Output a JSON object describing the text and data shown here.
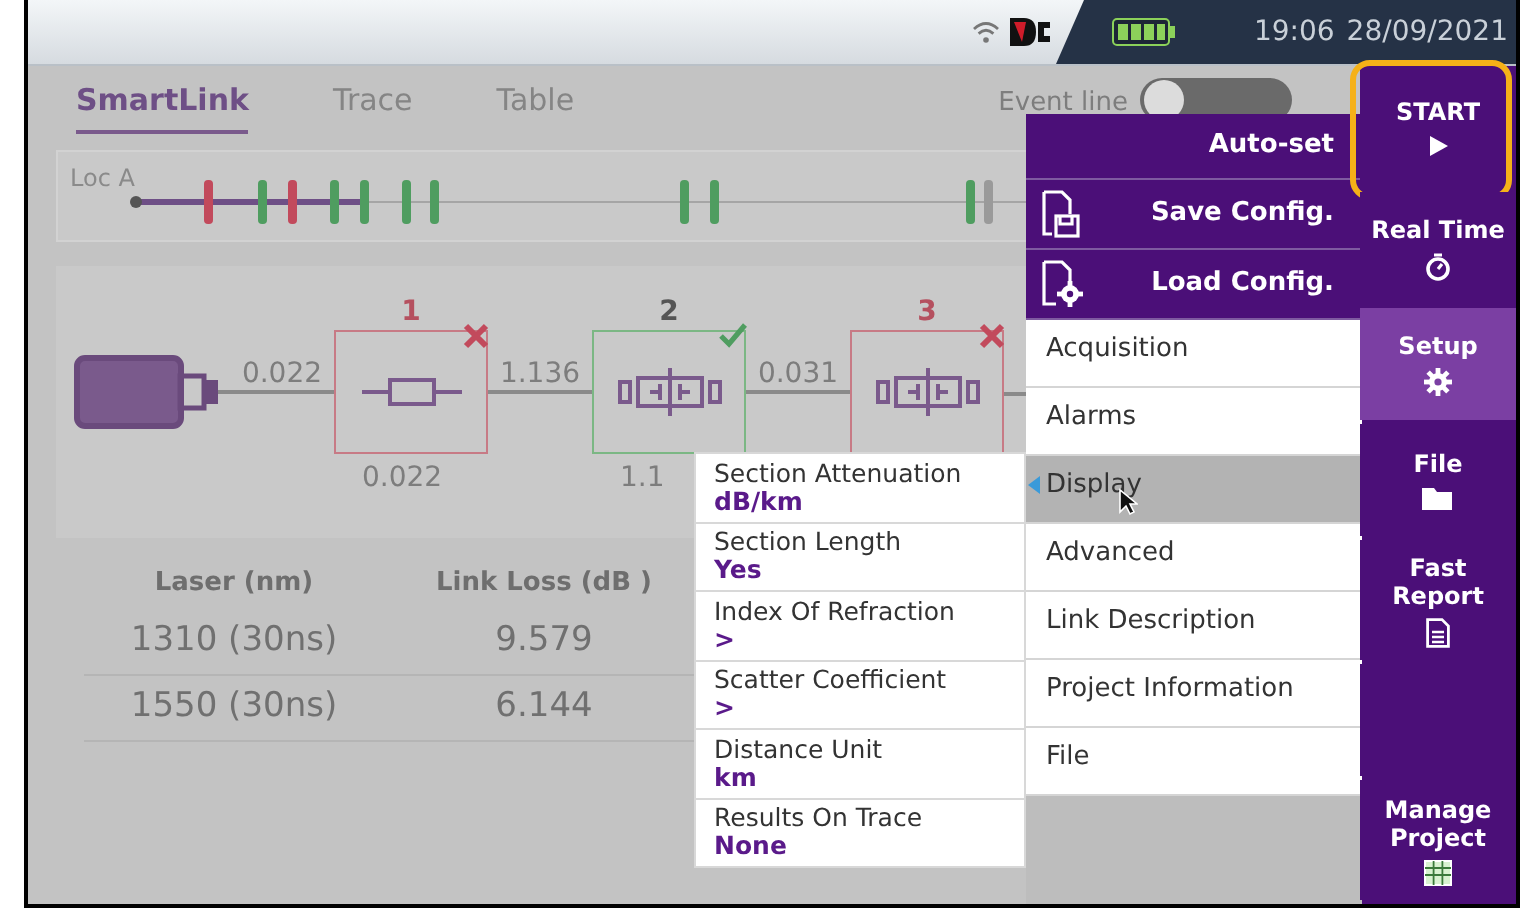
{
  "status_bar": {
    "time": "19:06",
    "date": "28/09/2021"
  },
  "tabs": [
    {
      "label": "SmartLink",
      "selected": true
    },
    {
      "label": "Trace",
      "selected": false
    },
    {
      "label": "Table",
      "selected": false
    }
  ],
  "event_line": {
    "label": "Event line",
    "on": false
  },
  "event_strip": {
    "start_label": "Loc A",
    "events": [
      {
        "color": "#c24a5c"
      },
      {
        "color": "#4f9d60"
      },
      {
        "color": "#c24a5c"
      },
      {
        "color": "#4f9d60"
      },
      {
        "color": "#4f9d60"
      },
      {
        "color": "#4f9d60"
      },
      {
        "color": "#4f9d60"
      },
      {
        "color": "#4f9d60"
      },
      {
        "color": "#4f9d60"
      },
      {
        "color": "#4f9d60"
      },
      {
        "color": "#9a9a9a"
      }
    ]
  },
  "link_diagram": {
    "sections": [
      "0.022",
      "1.136",
      "0.031"
    ],
    "events": [
      {
        "number": "1",
        "passed": false,
        "kind": "splice",
        "loss": "0.022"
      },
      {
        "number": "2",
        "passed": true,
        "kind": "connector",
        "loss": "1.1"
      },
      {
        "number": "3",
        "passed": false,
        "kind": "connector"
      }
    ]
  },
  "results_table": {
    "columns": [
      "Laser (nm)",
      "Link Loss (dB )"
    ],
    "rows": [
      [
        "1310 (30ns)",
        "9.579"
      ],
      [
        "1550 (30ns)",
        "6.144"
      ]
    ]
  },
  "sidebar": [
    {
      "label": "START",
      "kind": "play",
      "selected": false,
      "highlighted": true
    },
    {
      "label": "Real Time",
      "kind": "timer",
      "selected": false,
      "highlighted": false
    },
    {
      "label": "Setup",
      "kind": "gear",
      "selected": true,
      "highlighted": false
    },
    {
      "label": "File",
      "kind": "folder",
      "selected": false,
      "highlighted": false
    },
    {
      "label": "Fast Report",
      "kind": "report",
      "selected": false,
      "highlighted": false
    },
    {
      "kind": "empty",
      "selected": false,
      "highlighted": false
    },
    {
      "label": "Manage Project",
      "kind": "grid",
      "selected": false,
      "highlighted": false
    }
  ],
  "config_menu": [
    {
      "label": "Auto-set",
      "kind": "plain"
    },
    {
      "label": "Save Config.",
      "kind": "save"
    },
    {
      "label": "Load Config.",
      "kind": "load"
    }
  ],
  "setup_menu": [
    {
      "label": "Acquisition",
      "selected": false
    },
    {
      "label": "Alarms",
      "selected": false
    },
    {
      "label": "Display",
      "selected": true
    },
    {
      "label": "Advanced",
      "selected": false
    },
    {
      "label": "Link Description",
      "selected": false
    },
    {
      "label": "Project Information",
      "selected": false
    },
    {
      "label": "File",
      "selected": false
    }
  ],
  "display_options": [
    {
      "label": "Section Attenuation",
      "value": "dB/km"
    },
    {
      "label": "Section Length",
      "value": "Yes"
    },
    {
      "label": "Index Of Refraction",
      "value": ">"
    },
    {
      "label": "Scatter Coefficient",
      "value": ">"
    },
    {
      "label": "Distance Unit",
      "value": "km"
    },
    {
      "label": "Results On Trace",
      "value": "None"
    }
  ]
}
